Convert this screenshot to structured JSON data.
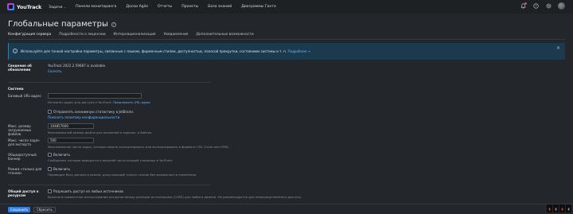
{
  "app": {
    "name": "YouTrack"
  },
  "nav": [
    {
      "label": "Задачи",
      "dropdown": true
    },
    {
      "label": "Панели мониторинга",
      "dropdown": false
    },
    {
      "label": "Доски Agile",
      "dropdown": false
    },
    {
      "label": "Отчеты",
      "dropdown": false
    },
    {
      "label": "Проекты",
      "dropdown": false
    },
    {
      "label": "База знаний",
      "dropdown": false
    },
    {
      "label": "Диаграммы Ганта",
      "dropdown": false
    }
  ],
  "page": {
    "title": "Глобальные параметры",
    "tabs": [
      "Конфигурация сервера",
      "Подробности о лицензии",
      "Интернационализация",
      "Уведомления",
      "Дополнительные возможности"
    ],
    "banner": {
      "text": "Используйте для тонкой настройки параметры, связанные с языком, фирменным стилем, доступностью, полосой прокрутки, состоянием системы и т. п.",
      "link": "Подробнее →"
    }
  },
  "update": {
    "label": "Сведения об обновлении",
    "value": "YouTrack 2022.2.59687 is available.",
    "link": "Скачать"
  },
  "system": {
    "heading": "Система",
    "base_url": {
      "label": "Базовый URL-адрес",
      "value": "",
      "hint": "Интернет-адрес для доступа к YouTrack.",
      "hint_link": "Предложить URL-адрес"
    },
    "stats": {
      "label": "Отправлять анонимную статистику в JetBrains",
      "link": "Показать политику конфиденциальности"
    },
    "max_upload": {
      "label": "Макс. размер загружаемых файлов",
      "value": "104857600",
      "hint": "Максимальный размер файла для вложений в задачах, в байтах."
    },
    "max_export": {
      "label": "Макс. число задач для экспорта",
      "value": "500",
      "hint": "Максимальное число задач, которое можно экспортировать или экспортировать в формате CSV, Excel или HTML."
    },
    "public_banner": {
      "label": "Общедоступный баннер",
      "checkbox": "Включить",
      "hint": "Сообщение, которое выводится в верхней части каждой страницы в YouTrack."
    },
    "readonly": {
      "label": "Режим «только для чтения»",
      "checkbox": "Включить",
      "hint": "Переводит базу данных в режим, допускающий только чтение без возможности изменения."
    }
  },
  "cors": {
    "label": "Общий доступ к ресурсам",
    "checkbox": "Разрешить доступ из любых источников",
    "hint": "Включите совместное использование ресурсов между разными источниками (CORS) для любого домена. Не рекомендуется для непосредственного доступа."
  },
  "footer": {
    "save": "Сохранить",
    "reset": "Сбросить"
  },
  "colors": {
    "accent": "#2f7de1",
    "background": "#23272b",
    "banner": "#1c3a4d",
    "link": "#6fb5ff"
  }
}
